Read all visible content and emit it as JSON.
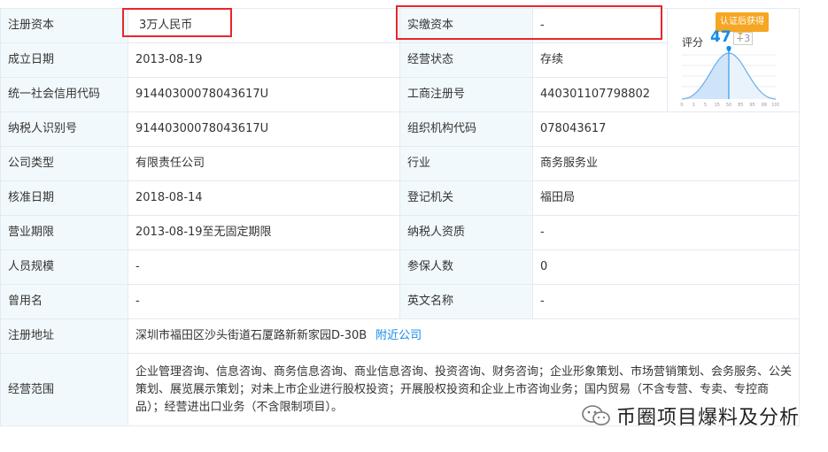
{
  "rows": [
    {
      "l1": "注册资本",
      "v1": "3万人民币",
      "l2": "实缴资本",
      "v2": "-"
    },
    {
      "l1": "成立日期",
      "v1": "2013-08-19",
      "l2": "经营状态",
      "v2": "存续"
    },
    {
      "l1": "统一社会信用代码",
      "v1": "91440300078043617U",
      "l2": "工商注册号",
      "v2": "440301107798802"
    },
    {
      "l1": "纳税人识别号",
      "v1": "91440300078043617U",
      "l2": "组织机构代码",
      "v2": "078043617"
    },
    {
      "l1": "公司类型",
      "v1": "有限责任公司",
      "l2": "行业",
      "v2": "商务服务业"
    },
    {
      "l1": "核准日期",
      "v1": "2018-08-14",
      "l2": "登记机关",
      "v2": "福田局"
    },
    {
      "l1": "营业期限",
      "v1": "2013-08-19至无固定期限",
      "l2": "纳税人资质",
      "v2": "-"
    },
    {
      "l1": "人员规模",
      "v1": "-",
      "l2": "参保人数",
      "v2": "0"
    },
    {
      "l1": "曾用名",
      "v1": "-",
      "l2": "英文名称",
      "v2": "-"
    }
  ],
  "address": {
    "label": "注册地址",
    "value": "深圳市福田区沙头街道石厦路新新家园D-30B",
    "link": "附近公司"
  },
  "scope": {
    "label": "经营范围",
    "value": "企业管理咨询、信息咨询、商务信息咨询、商业信息咨询、投资咨询、财务咨询；企业形象策划、市场营销策划、会务服务、公关策划、展览展示策划；对未上市企业进行股权投资；开展股权投资和企业上市咨询业务；国内贸易（不含专营、专卖、专控商品）；经营进出口业务（不含限制项目）。"
  },
  "score": {
    "badge": "认证后获得",
    "label": "评分",
    "value": "47",
    "delta": "+3",
    "ticks": [
      "0",
      "1",
      "5",
      "15",
      "50",
      "85",
      "95",
      "99",
      "100"
    ]
  },
  "watermark": {
    "text": "币圈项目爆料及分析"
  },
  "colors": {
    "accent": "#128bed",
    "label_bg": "#f2f9fc",
    "border": "#e4eaf3",
    "highlight": "#e8262d",
    "badge": "#f5a623"
  }
}
